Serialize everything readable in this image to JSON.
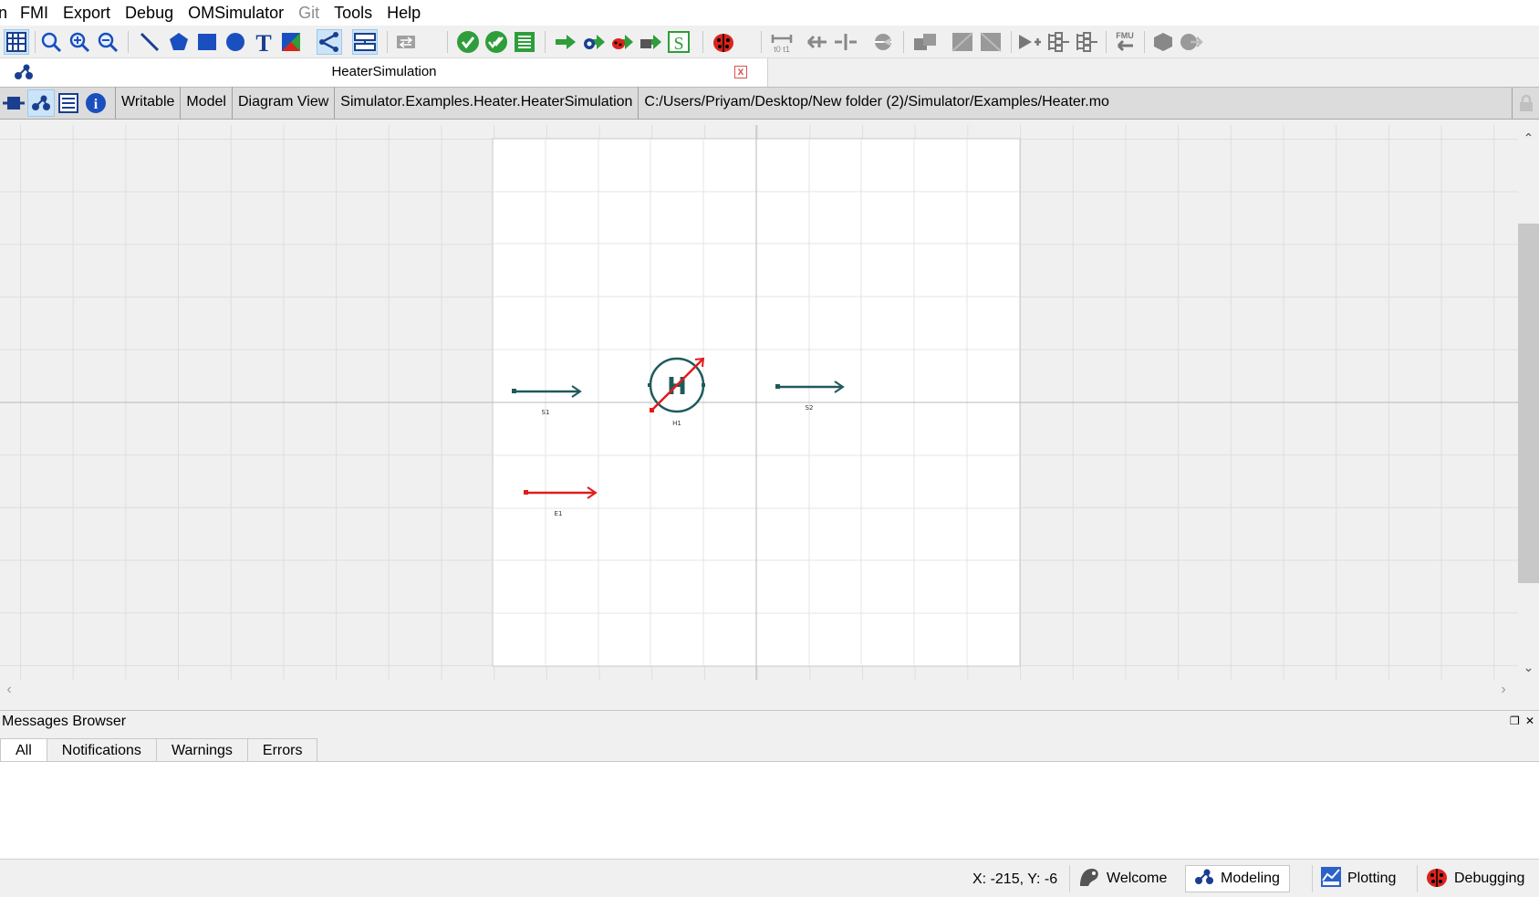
{
  "menu": [
    "n",
    "FMI",
    "Export",
    "Debug",
    "OMSimulator",
    "Git",
    "Tools",
    "Help"
  ],
  "menu_disabled": [
    "Git"
  ],
  "toolbar": {
    "icons": [
      "grid-icon",
      "zoom-reset-icon",
      "zoom-in-icon",
      "zoom-out-icon",
      "line-icon",
      "polygon-icon",
      "rectangle-icon",
      "ellipse-icon",
      "text-icon",
      "bitmap-icon",
      "connect-mode-icon",
      "transition-mode-icon",
      "swap-dropdown-icon",
      "check-model-icon",
      "check-all-models-icon",
      "instantiate-model-icon",
      "simulate-icon",
      "simulate-setup-icon",
      "simulate-debug-icon",
      "simulate-algorithmic-debug-icon",
      "simulate-s-icon",
      "debug-dropdown-icon",
      "t0-t1-icon",
      "connect-arrow-icon",
      "split-icon",
      "animation-icon",
      "export-fmu-icon",
      "new-fmu-icon",
      "edit-fmu-icon",
      "add-connector-icon",
      "add-bus-icon",
      "add-tlm-bus-icon",
      "import-fmu-icon",
      "ssp-export-icon",
      "ssp-import-icon"
    ]
  },
  "tab": {
    "title": "HeaterSimulation",
    "close_symbol": "x"
  },
  "infobar": {
    "segments": [
      "Writable",
      "Model",
      "Diagram View",
      "Simulator.Examples.Heater.HeaterSimulation",
      "C:/Users/Priyam/Desktop/New folder (2)/Simulator/Examples/Heater.mo"
    ]
  },
  "diagram": {
    "components": [
      {
        "name": "S1",
        "kind": "output-arrow",
        "color": "#1f5a5a"
      },
      {
        "name": "H1",
        "kind": "heater",
        "symbol_text": "H",
        "color": "#1f5a5a",
        "accent": "#e31a1c"
      },
      {
        "name": "S2",
        "kind": "output-arrow",
        "color": "#1f5a5a"
      },
      {
        "name": "E1",
        "kind": "input-arrow",
        "color": "#e31a1c"
      }
    ]
  },
  "messages": {
    "title": "Messages Browser",
    "tabs": [
      "All",
      "Notifications",
      "Warnings",
      "Errors"
    ],
    "active_tab": "All"
  },
  "status": {
    "coords": "X: -215, Y: -6",
    "perspectives": [
      {
        "label": "Welcome",
        "icon": "welcome-icon"
      },
      {
        "label": "Modeling",
        "icon": "modeling-icon"
      },
      {
        "label": "Plotting",
        "icon": "plotting-icon"
      },
      {
        "label": "Debugging",
        "icon": "debugging-icon"
      }
    ],
    "active_perspective": "Modeling"
  }
}
